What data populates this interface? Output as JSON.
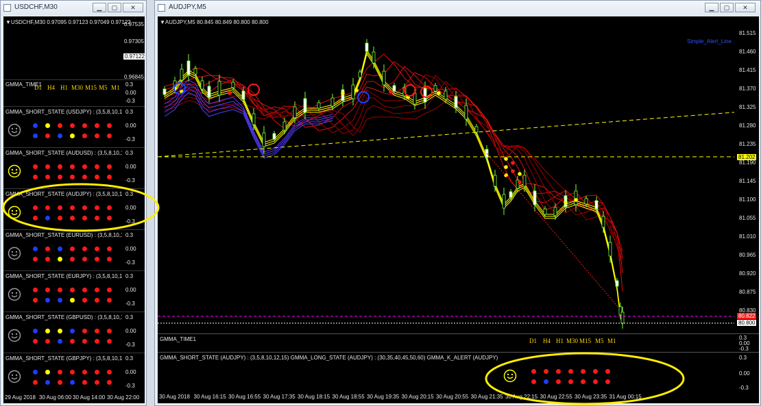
{
  "left_window": {
    "title": "USDCHF,M30",
    "chart_header": "▼USDCHF,M30  0.97095 0.97123 0.97049 0.97122",
    "price_ticks": [
      "0.97535",
      "0.97305",
      "0.97122",
      "0.96845"
    ],
    "price_badge": "0.97122",
    "time_panel": {
      "title": "GMMA_TIME1",
      "labels": [
        "D1",
        "H4",
        "H1",
        "M30",
        "M15",
        "M5",
        "M1"
      ],
      "ticks": [
        "0.3",
        "0.00",
        "-0.3"
      ]
    },
    "state_panels": [
      {
        "title": "GMMA_SHORT_STATE (USDJPY) : (3,5,8,10,12,15)",
        "mood": "neutral",
        "top": [
          "blue",
          "yellow",
          "red",
          "red",
          "red",
          "red",
          "red"
        ],
        "bottom": [
          "blue",
          "red",
          "blue",
          "yellow",
          "red",
          "red",
          "red"
        ],
        "ticks": [
          "0.3",
          "0.00",
          "-0.3"
        ]
      },
      {
        "title": "GMMA_SHORT_STATE (AUDUSD) : (3,5,8,10,12,15)",
        "mood": "happy",
        "top": [
          "red",
          "red",
          "red",
          "red",
          "red",
          "red",
          "red"
        ],
        "bottom": [
          "red",
          "red",
          "red",
          "red",
          "red",
          "red",
          "red"
        ],
        "ticks": [
          "0.3",
          "0.00",
          "-0.3"
        ]
      },
      {
        "title": "GMMA_SHORT_STATE (AUDJPY) : (3,5,8,10,12,15)",
        "mood": "happy",
        "top": [
          "red",
          "red",
          "red",
          "red",
          "red",
          "red",
          "red"
        ],
        "bottom": [
          "red",
          "blue",
          "red",
          "red",
          "red",
          "red",
          "red"
        ],
        "ticks": [
          "0.3",
          "0.00",
          "-0.3"
        ]
      },
      {
        "title": "GMMA_SHORT_STATE (EURUSD) : (3,5,8,10,12,15)",
        "mood": "neutral",
        "top": [
          "blue",
          "red",
          "blue",
          "red",
          "red",
          "red",
          "red"
        ],
        "bottom": [
          "red",
          "red",
          "yellow",
          "red",
          "red",
          "red",
          "red"
        ],
        "ticks": [
          "0.3",
          "0.00",
          "-0.3"
        ]
      },
      {
        "title": "GMMA_SHORT_STATE (EURJPY) : (3,5,8,10,12,15)",
        "mood": "neutral",
        "top": [
          "red",
          "red",
          "red",
          "red",
          "red",
          "red",
          "red"
        ],
        "bottom": [
          "red",
          "blue",
          "blue",
          "yellow",
          "red",
          "red",
          "red"
        ],
        "ticks": [
          "0.3",
          "0.00",
          "-0.3"
        ]
      },
      {
        "title": "GMMA_SHORT_STATE (GBPUSD) : (3,5,8,10,12,15)",
        "mood": "neutral",
        "top": [
          "blue",
          "yellow",
          "yellow",
          "blue",
          "red",
          "red",
          "red"
        ],
        "bottom": [
          "red",
          "red",
          "blue",
          "red",
          "red",
          "red",
          "red"
        ],
        "ticks": [
          "0.3",
          "0.00",
          "-0.3"
        ]
      },
      {
        "title": "GMMA_SHORT_STATE (GBPJPY) : (3,5,8,10,12,15)",
        "mood": "neutral",
        "top": [
          "blue",
          "yellow",
          "red",
          "red",
          "red",
          "red",
          "red"
        ],
        "bottom": [
          "red",
          "blue",
          "red",
          "blue",
          "red",
          "red",
          "red"
        ],
        "ticks": [
          "0.3",
          "0.00",
          "-0.3"
        ]
      }
    ],
    "x_labels": [
      "29 Aug 2018",
      "30 Aug 06:00",
      "30 Aug 14:00",
      "30 Aug 22:00"
    ]
  },
  "right_window": {
    "title": "AUDJPY,M5",
    "chart_header": "▼AUDJPY,M5  80.845 80.849 80.800 80.800",
    "alert_label": "Simple_Alert_Line",
    "price_ticks": [
      "81.515",
      "81.460",
      "81.415",
      "81.370",
      "81.325",
      "81.280",
      "81.235",
      "81.190",
      "81.145",
      "81.100",
      "81.055",
      "81.010",
      "80.965",
      "80.920",
      "80.875",
      "80.830"
    ],
    "line_badge": "81.202",
    "alert_badge": "80.822",
    "price_badge": "80.800",
    "time_panel": {
      "title": "GMMA_TIME1",
      "labels": [
        "D1",
        "H4",
        "H1",
        "M30",
        "M15",
        "M5",
        "M1"
      ],
      "ticks": [
        "0.3",
        "0.00",
        "-0.3"
      ]
    },
    "state_panel": {
      "title": "GMMA_SHORT_STATE (AUDJPY) : (3,5,8,10,12,15)  GMMA_LONG_STATE (AUDJPY) : (30,35,40,45,50,60)  GMMA_K_ALERT (AUDJPY)",
      "mood": "happy",
      "top": [
        "red",
        "red",
        "red",
        "red",
        "red",
        "red",
        "red"
      ],
      "bottom": [
        "red",
        "blue",
        "red",
        "red",
        "red",
        "red",
        "red"
      ],
      "ticks": [
        "0.3",
        "0.00",
        "-0.3"
      ]
    },
    "x_labels": [
      "30 Aug 2018",
      "30 Aug 16:15",
      "30 Aug 16:55",
      "30 Aug 17:35",
      "30 Aug 18:15",
      "30 Aug 18:55",
      "30 Aug 19:35",
      "30 Aug 20:15",
      "30 Aug 20:55",
      "30 Aug 21:35",
      "30 Aug 22:15",
      "30 Aug 22:55",
      "30 Aug 23:35",
      "31 Aug 00:15"
    ]
  },
  "colors": {
    "red": "#ff1a1a",
    "blue": "#1e3cff",
    "yellow": "#ffff00",
    "highlight": "#ffee00",
    "alert_line": "#ff00ff"
  }
}
